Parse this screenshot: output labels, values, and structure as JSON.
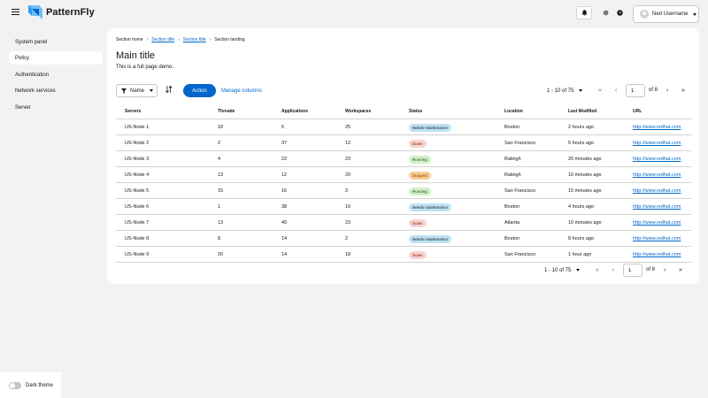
{
  "header": {
    "brand": "PatternFly",
    "user_name": "Ned Username"
  },
  "sidebar": {
    "items": [
      {
        "label": "System panel",
        "active": false
      },
      {
        "label": "Policy",
        "active": true
      },
      {
        "label": "Authentication",
        "active": false
      },
      {
        "label": "Network services",
        "active": false
      },
      {
        "label": "Server",
        "active": false
      }
    ],
    "theme_toggle_label": "Dark theme"
  },
  "breadcrumb": [
    "Section home",
    "Section title",
    "Section title",
    "Section landing"
  ],
  "page": {
    "title": "Main title",
    "subtitle": "This is a full page demo."
  },
  "toolbar": {
    "filter_label": "Name",
    "action_label": "Action",
    "manage_columns_label": "Manage columns"
  },
  "pagination": {
    "range": "1 - 10 of 75",
    "page": "1",
    "of_pages": "of 8"
  },
  "table": {
    "columns": [
      "Servers",
      "Threads",
      "Applications",
      "Workspaces",
      "Status",
      "Location",
      "Last Modified",
      "URL"
    ],
    "rows": [
      {
        "server": "US-Node 1",
        "threads": "18",
        "apps": "5",
        "ws": "25",
        "status": "Needs maintenance",
        "location": "Boston",
        "modified": "2 hours ago",
        "url": "http://www.redhat.com"
      },
      {
        "server": "US-Node 2",
        "threads": "2",
        "apps": "37",
        "ws": "12",
        "status": "Down",
        "location": "San Francisco",
        "modified": "5 hours ago",
        "url": "http://www.redhat.com"
      },
      {
        "server": "US-Node 3",
        "threads": "4",
        "apps": "22",
        "ws": "23",
        "status": "Running",
        "location": "Raleigh",
        "modified": "20 minutes ago",
        "url": "http://www.redhat.com"
      },
      {
        "server": "US-Node 4",
        "threads": "13",
        "apps": "12",
        "ws": "20",
        "status": "Stopped",
        "location": "Raleigh",
        "modified": "10 minutes ago",
        "url": "http://www.redhat.com"
      },
      {
        "server": "US-Node 5",
        "threads": "15",
        "apps": "16",
        "ws": "3",
        "status": "Running",
        "location": "San Francisco",
        "modified": "15 minutes ago",
        "url": "http://www.redhat.com"
      },
      {
        "server": "US-Node 6",
        "threads": "1",
        "apps": "38",
        "ws": "10",
        "status": "Needs maintenance",
        "location": "Boston",
        "modified": "4 hours ago",
        "url": "http://www.redhat.com"
      },
      {
        "server": "US-Node 7",
        "threads": "13",
        "apps": "40",
        "ws": "23",
        "status": "Down",
        "location": "Atlanta",
        "modified": "10 minutes ago",
        "url": "http://www.redhat.com"
      },
      {
        "server": "US-Node 8",
        "threads": "8",
        "apps": "14",
        "ws": "2",
        "status": "Needs maintenance",
        "location": "Boston",
        "modified": "8 hours ago",
        "url": "http://www.redhat.com"
      },
      {
        "server": "US-Node 9",
        "threads": "20",
        "apps": "14",
        "ws": "18",
        "status": "Down",
        "location": "San Francisco",
        "modified": "1 hour ago",
        "url": "http://www.redhat.com"
      }
    ]
  },
  "status_colors": {
    "Needs maintenance": {
      "bg": "#bee1f4",
      "fg": "#151515"
    },
    "Down": {
      "bg": "#fad2d2",
      "fg": "#7d1007"
    },
    "Running": {
      "bg": "#d1f1c4",
      "fg": "#1e4f18"
    },
    "Stopped": {
      "bg": "#fccb8f",
      "fg": "#73480b"
    }
  }
}
